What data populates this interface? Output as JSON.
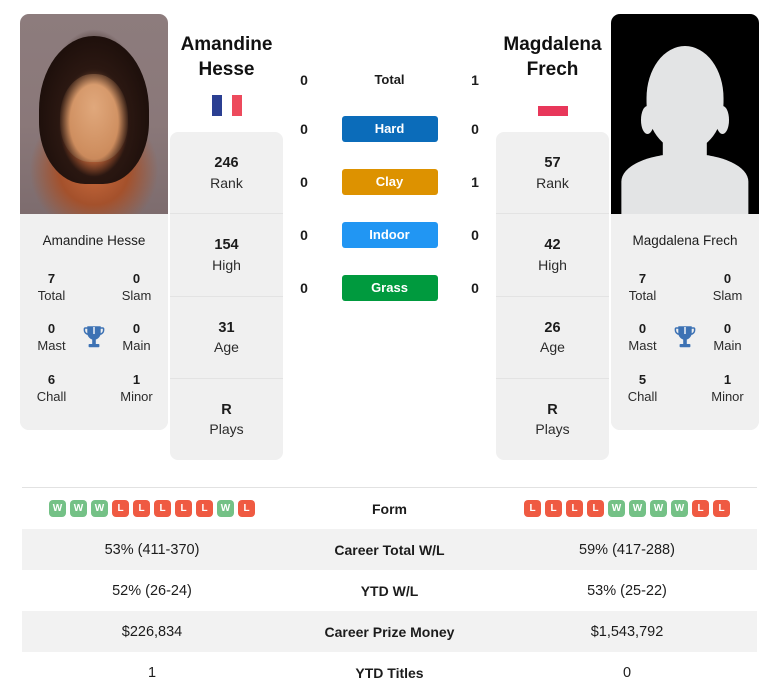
{
  "players": {
    "left": {
      "name_line1": "Amandine",
      "name_line2": "Hesse",
      "full_name": "Amandine Hesse",
      "photo_caption": "Amandine Hesse",
      "flag": "france-flag",
      "flag_colors": [
        "#2b3f92",
        "#ffffff",
        "#ed4a5c"
      ],
      "titles": [
        {
          "value": "7",
          "label": "Total"
        },
        {
          "value": "0",
          "label": "Slam"
        },
        {
          "value": "0",
          "label": "Mast"
        },
        {
          "value": "0",
          "label": "Main"
        },
        {
          "value": "6",
          "label": "Chall"
        },
        {
          "value": "1",
          "label": "Minor"
        }
      ],
      "info": [
        {
          "value": "246",
          "label": "Rank"
        },
        {
          "value": "154",
          "label": "High"
        },
        {
          "value": "31",
          "label": "Age"
        },
        {
          "value": "R",
          "label": "Plays"
        }
      ],
      "h2h": {
        "total": "0",
        "hard": "0",
        "clay": "0",
        "indoor": "0",
        "grass": "0"
      },
      "form": [
        "W",
        "W",
        "W",
        "L",
        "L",
        "L",
        "L",
        "L",
        "W",
        "L"
      ],
      "career_wl": "53% (411-370)",
      "ytd_wl": "52% (26-24)",
      "career_prize_money": "$226,834",
      "ytd_titles": "1"
    },
    "right": {
      "name_line1": "Magdalena",
      "name_line2": "Frech",
      "full_name": "Magdalena Frech",
      "photo_caption": "Magdalena Frech",
      "flag": "poland-flag",
      "flag_colors": [
        "#ffffff",
        "#e8375a"
      ],
      "titles": [
        {
          "value": "7",
          "label": "Total"
        },
        {
          "value": "0",
          "label": "Slam"
        },
        {
          "value": "0",
          "label": "Mast"
        },
        {
          "value": "0",
          "label": "Main"
        },
        {
          "value": "5",
          "label": "Chall"
        },
        {
          "value": "1",
          "label": "Minor"
        }
      ],
      "info": [
        {
          "value": "57",
          "label": "Rank"
        },
        {
          "value": "42",
          "label": "High"
        },
        {
          "value": "26",
          "label": "Age"
        },
        {
          "value": "R",
          "label": "Plays"
        }
      ],
      "h2h": {
        "total": "1",
        "hard": "0",
        "clay": "1",
        "indoor": "0",
        "grass": "0"
      },
      "form": [
        "L",
        "L",
        "L",
        "L",
        "W",
        "W",
        "W",
        "W",
        "L",
        "L"
      ],
      "career_wl": "59% (417-288)",
      "ytd_wl": "53% (25-22)",
      "career_prize_money": "$1,543,792",
      "ytd_titles": "0"
    }
  },
  "h2h": {
    "total_label": "Total",
    "surfaces": [
      {
        "key": "hard",
        "label": "Hard",
        "color": "#0b6cba"
      },
      {
        "key": "clay",
        "label": "Clay",
        "color": "#dd9200"
      },
      {
        "key": "indoor",
        "label": "Indoor",
        "color": "#2196f3"
      },
      {
        "key": "grass",
        "label": "Grass",
        "color": "#009a3e"
      }
    ]
  },
  "stats_table": {
    "rows": [
      {
        "label": "Form",
        "type": "form"
      },
      {
        "label": "Career Total W/L",
        "type": "text"
      },
      {
        "label": "YTD W/L",
        "type": "text"
      },
      {
        "label": "Career Prize Money",
        "type": "text"
      },
      {
        "label": "YTD Titles",
        "type": "text"
      }
    ]
  },
  "colors": {
    "win_badge": "#74c186",
    "loss_badge": "#ef5a42",
    "trophy": "#3d72b4",
    "card_bg": "#f0f0f0",
    "row_alt_bg": "#f2f2f2"
  }
}
